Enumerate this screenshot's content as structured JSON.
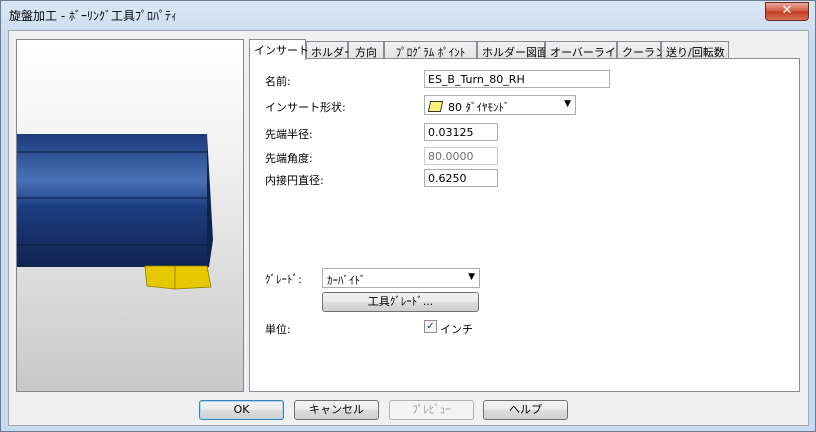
{
  "window": {
    "title": "旋盤加工 - ﾎﾞｰﾘﾝｸﾞ工具ﾌﾟﾛﾊﾟﾃｨ",
    "close_glyph": "✕"
  },
  "tabs": [
    {
      "label": "インサート",
      "active": true
    },
    {
      "label": "ホルダー",
      "active": false
    },
    {
      "label": "方向",
      "active": false
    },
    {
      "label": "ﾌﾟﾛｸﾞﾗﾑ ﾎﾟｲﾝﾄ",
      "active": false
    },
    {
      "label": "ホルダー図面",
      "active": false
    },
    {
      "label": "オーバーライド",
      "active": false
    },
    {
      "label": "クーラント",
      "active": false
    },
    {
      "label": "送り/回転数",
      "active": false
    }
  ],
  "form": {
    "name_label": "名前:",
    "name_value": "ES_B_Turn_80_RH",
    "insert_shape_label": "インサート形状:",
    "insert_shape_value": "80 ﾀﾞｲﾔﾓﾝﾄﾞ",
    "tip_radius_label": "先端半径:",
    "tip_radius_value": "0.03125",
    "tip_angle_label": "先端角度:",
    "tip_angle_value": "80.0000",
    "ic_label": "内接円直径:",
    "ic_value": "0.6250",
    "grade_label": "ｸﾞﾚｰﾄﾞ:",
    "grade_value": "ｶｰﾊﾞｲﾄﾞ",
    "tool_grade_button": "工具ｸﾞﾚｰﾄﾞ...",
    "unit_label": "単位:",
    "unit_checkbox_label": "インチ",
    "unit_checked": true
  },
  "buttons": {
    "ok": "OK",
    "cancel": "キャンセル",
    "preview": "ﾌﾟﾚﾋﾞｭｰ",
    "help": "ヘルプ"
  },
  "colors": {
    "tool_body": "#1f3c78",
    "insert": "#e6c800"
  }
}
